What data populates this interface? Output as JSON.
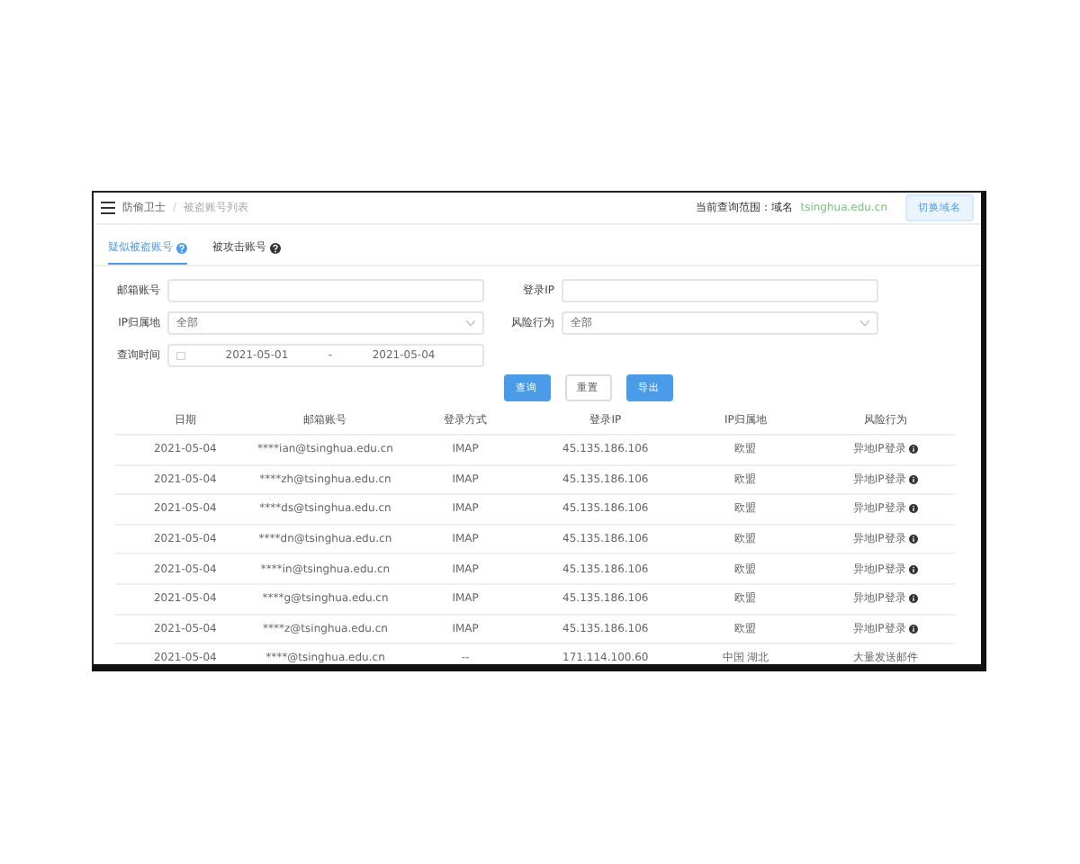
{
  "header": {
    "breadcrumb": [
      "防偷卫士",
      "/",
      "被盗账号列表"
    ],
    "scope_label": "当前查询范围：域名",
    "scope_value": "tsinghua.edu.cn",
    "switch_button": "切换域名"
  },
  "tabs": [
    {
      "label": "疑似被盗账号",
      "selected": true
    },
    {
      "label": "被攻击账号",
      "selected": false
    }
  ],
  "filters": [
    {
      "label": "邮箱账号",
      "kind": "text"
    },
    {
      "label": "登录IP",
      "kind": "text"
    },
    {
      "label": "IP归属地",
      "kind": "select",
      "value": "全部"
    },
    {
      "label": "风险行为",
      "kind": "select",
      "value": "全部"
    },
    {
      "label": "查询时间",
      "kind": "daterange",
      "start": "2021-05-01",
      "separator": "-",
      "end": "2021-05-04"
    }
  ],
  "buttons": [
    {
      "label": "查询",
      "primary": true
    },
    {
      "label": "重置",
      "primary": false
    },
    {
      "label": "导出",
      "primary": true
    }
  ],
  "table": {
    "columns": [
      "日期",
      "邮箱账号",
      "登录方式",
      "登录IP",
      "IP归属地",
      "风险行为"
    ],
    "rows": [
      {
        "cells": [
          "2021-05-04",
          "****ian@tsinghua.edu.cn",
          "IMAP",
          "45.135.186.106",
          "欧盟",
          "异地IP登录"
        ],
        "info": true
      },
      {
        "cells": [
          "2021-05-04",
          "****zh@tsinghua.edu.cn",
          "IMAP",
          "45.135.186.106",
          "欧盟",
          "异地IP登录"
        ],
        "info": true
      },
      {
        "cells": [
          "2021-05-04",
          "****ds@tsinghua.edu.cn",
          "IMAP",
          "45.135.186.106",
          "欧盟",
          "异地IP登录"
        ],
        "info": true
      },
      {
        "cells": [
          "2021-05-04",
          "****dn@tsinghua.edu.cn",
          "IMAP",
          "45.135.186.106",
          "欧盟",
          "异地IP登录"
        ],
        "info": true
      },
      {
        "cells": [
          "2021-05-04",
          "****in@tsinghua.edu.cn",
          "IMAP",
          "45.135.186.106",
          "欧盟",
          "异地IP登录"
        ],
        "info": true
      },
      {
        "cells": [
          "2021-05-04",
          "****g@tsinghua.edu.cn",
          "IMAP",
          "45.135.186.106",
          "欧盟",
          "异地IP登录"
        ],
        "info": true
      },
      {
        "cells": [
          "2021-05-04",
          "****z@tsinghua.edu.cn",
          "IMAP",
          "45.135.186.106",
          "欧盟",
          "异地IP登录"
        ],
        "info": true
      },
      {
        "cells": [
          "2021-05-04",
          "****@tsinghua.edu.cn",
          "--",
          "171.114.100.60",
          "中国 湖北",
          "大量发送邮件"
        ],
        "info": false
      }
    ]
  }
}
